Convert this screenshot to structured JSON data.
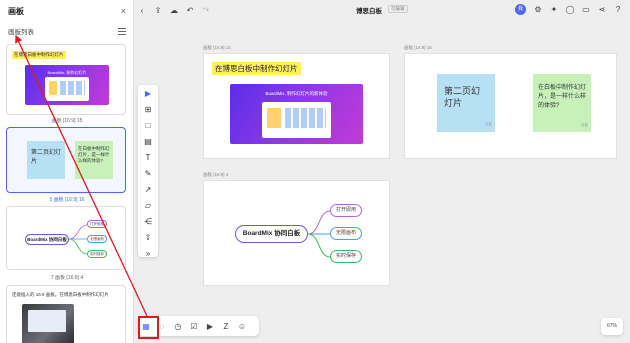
{
  "panel": {
    "title": "画板",
    "close_glyph": "×",
    "subtitle": "画板列表",
    "thumbs": [
      {
        "title": "在博思白板中制作幻灯片",
        "graphic_text": "BoardMix, 制作幻灯片",
        "caption": "画板 [16:9] 15"
      },
      {
        "blue_text": "第二页幻灯片",
        "green_text": "在白板中制作幻灯片，是一样什么样的体验?",
        "caption": "5 画板 [16:9] 16"
      },
      {
        "center": "BoardMix 协同白板",
        "leaves": [
          "打开即用",
          "无限画布",
          "实时保存"
        ],
        "caption": "7 画板 [16:9] 4"
      },
      {
        "title": "还能插入的 16:9 画板。在博思白板中制作幻灯片"
      }
    ]
  },
  "topbar": {
    "icons": [
      {
        "name": "back-icon",
        "glyph": "‹"
      },
      {
        "name": "export-icon",
        "glyph": "⇪"
      },
      {
        "name": "cloud-icon",
        "glyph": "☁"
      },
      {
        "name": "undo-icon",
        "glyph": "↶"
      },
      {
        "name": "redo-icon",
        "glyph": "↷"
      }
    ],
    "title": "博思白板",
    "badge": "可编辑",
    "avatar": "我",
    "right_icons": [
      {
        "name": "settings-icon",
        "glyph": "⚙"
      },
      {
        "name": "magic-icon",
        "glyph": "✦"
      },
      {
        "name": "comment-icon",
        "glyph": "◯"
      },
      {
        "name": "present-icon",
        "glyph": "▭"
      },
      {
        "name": "share-icon",
        "glyph": "⋖"
      },
      {
        "name": "help-icon",
        "glyph": "?"
      }
    ]
  },
  "rail": [
    {
      "name": "select-tool-icon",
      "glyph": "▶"
    },
    {
      "name": "frame-tool-icon",
      "glyph": "⊞"
    },
    {
      "name": "shape-tool-icon",
      "glyph": "□"
    },
    {
      "name": "sticky-tool-icon",
      "glyph": "▤"
    },
    {
      "name": "text-tool-icon",
      "glyph": "T"
    },
    {
      "name": "pen-tool-icon",
      "glyph": "✎"
    },
    {
      "name": "connector-tool-icon",
      "glyph": "↗"
    },
    {
      "name": "note-tool-icon",
      "glyph": "▱"
    },
    {
      "name": "mindmap-tool-icon",
      "glyph": "⋲"
    },
    {
      "name": "upload-tool-icon",
      "glyph": "⇧"
    },
    {
      "name": "more-tools-icon",
      "glyph": "»"
    }
  ],
  "canvas": {
    "frame15": {
      "caption": "画板 [16:9] 15",
      "title": "在博思白板中制作幻灯片",
      "graphic_text": "BoardMix, 制作幻灯片的新体验"
    },
    "frame16": {
      "caption": "画板 [16:9] 16",
      "blue_text": "第二页幻灯片",
      "green_text": "在白板中制作幻灯片，是一样什么样的体验?",
      "by": "访客"
    },
    "frame4": {
      "caption": "画板 [16:9] 4",
      "center": "BoardMix 协同白板",
      "leaves": [
        "打开即用",
        "无限画布",
        "实时保存"
      ]
    }
  },
  "bottombar": [
    {
      "name": "frame-list-icon",
      "glyph": "▦"
    },
    {
      "name": "comment-tool-icon",
      "glyph": "◌"
    },
    {
      "name": "timer-icon",
      "glyph": "◷"
    },
    {
      "name": "vote-icon",
      "glyph": "☑"
    },
    {
      "name": "video-icon",
      "glyph": "▶"
    },
    {
      "name": "sleep-icon",
      "glyph": "Z"
    },
    {
      "name": "sticker-icon",
      "glyph": "☺"
    }
  ],
  "zoom": "67%",
  "colors": {
    "accent": "#4a67f5",
    "annotation_red": "#e0191e",
    "sticky_blue": "#b7e0f5",
    "sticky_green": "#c7f1b9",
    "highlight": "#ffef5a"
  }
}
